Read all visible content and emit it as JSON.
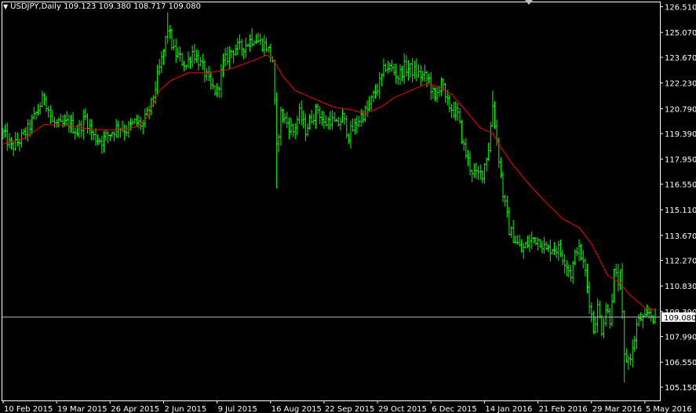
{
  "header": {
    "symbol_timeframe": "USDJPY,Daily",
    "ohlc": "109.123 109.380 108.717 109.080"
  },
  "colors": {
    "background": "#000000",
    "bars": "#00ff00",
    "moving_average": "#ff0000",
    "bid_line": "#c0c0c0",
    "axis": "#ffffff"
  },
  "chart_data": {
    "type": "ohlc",
    "title": "USDJPY,Daily",
    "current_price": 109.08,
    "ylim": [
      104.4,
      126.8
    ],
    "y_ticks": [
      126.51,
      125.07,
      123.67,
      122.23,
      120.79,
      119.39,
      117.95,
      116.55,
      115.11,
      113.67,
      112.27,
      110.83,
      109.39,
      107.99,
      106.55,
      105.15
    ],
    "y_tick_labels": [
      "126.510",
      "125.070",
      "123.670",
      "122.230",
      "120.790",
      "119.390",
      "117.950",
      "116.550",
      "115.110",
      "113.670",
      "112.270",
      "110.830",
      "109.390",
      "107.990",
      "106.550",
      "105.150"
    ],
    "x_ticks": [
      {
        "label": "10 Feb 2015",
        "index": 0
      },
      {
        "label": "19 Mar 2015",
        "index": 26
      },
      {
        "label": "26 Apr 2015",
        "index": 52
      },
      {
        "label": "2 Jun 2015",
        "index": 78
      },
      {
        "label": "9 Jul 2015",
        "index": 104
      },
      {
        "label": "16 Aug 2015",
        "index": 130
      },
      {
        "label": "22 Sep 2015",
        "index": 156
      },
      {
        "label": "29 Oct 2015",
        "index": 182
      },
      {
        "label": "6 Dec 2015",
        "index": 208
      },
      {
        "label": "14 Jan 2016",
        "index": 234
      },
      {
        "label": "21 Feb 2016",
        "index": 260
      },
      {
        "label": "29 Mar 2016",
        "index": 286
      },
      {
        "label": "5 May 2016",
        "index": 312
      }
    ],
    "close_anchors": [
      [
        0,
        119.4
      ],
      [
        4,
        118.6
      ],
      [
        8,
        119.0
      ],
      [
        12,
        119.6
      ],
      [
        16,
        120.5
      ],
      [
        20,
        121.5
      ],
      [
        24,
        120.0
      ],
      [
        28,
        119.8
      ],
      [
        32,
        120.0
      ],
      [
        36,
        119.5
      ],
      [
        40,
        120.3
      ],
      [
        44,
        119.2
      ],
      [
        48,
        119.0
      ],
      [
        52,
        119.4
      ],
      [
        56,
        119.8
      ],
      [
        60,
        119.6
      ],
      [
        64,
        120.0
      ],
      [
        68,
        119.9
      ],
      [
        72,
        121.0
      ],
      [
        75,
        122.5
      ],
      [
        78,
        124.0
      ],
      [
        80,
        125.3
      ],
      [
        83,
        124.0
      ],
      [
        86,
        123.6
      ],
      [
        89,
        123.2
      ],
      [
        92,
        124.0
      ],
      [
        95,
        123.5
      ],
      [
        98,
        122.8
      ],
      [
        101,
        122.0
      ],
      [
        104,
        121.7
      ],
      [
        107,
        123.3
      ],
      [
        110,
        123.9
      ],
      [
        113,
        124.2
      ],
      [
        116,
        124.2
      ],
      [
        119,
        124.5
      ],
      [
        122,
        124.8
      ],
      [
        125,
        124.5
      ],
      [
        128,
        124.3
      ],
      [
        131,
        123.5
      ],
      [
        133,
        118.5
      ],
      [
        135,
        120.5
      ],
      [
        138,
        120.0
      ],
      [
        141,
        119.5
      ],
      [
        144,
        120.5
      ],
      [
        147,
        119.6
      ],
      [
        150,
        120.3
      ],
      [
        153,
        120.8
      ],
      [
        156,
        119.9
      ],
      [
        159,
        120.2
      ],
      [
        162,
        119.8
      ],
      [
        165,
        120.3
      ],
      [
        168,
        119.3
      ],
      [
        171,
        119.8
      ],
      [
        174,
        120.4
      ],
      [
        177,
        120.7
      ],
      [
        180,
        121.5
      ],
      [
        183,
        122.2
      ],
      [
        186,
        123.2
      ],
      [
        189,
        123.0
      ],
      [
        192,
        122.6
      ],
      [
        195,
        123.1
      ],
      [
        198,
        123.0
      ],
      [
        201,
        122.8
      ],
      [
        204,
        122.6
      ],
      [
        207,
        122.4
      ],
      [
        210,
        121.2
      ],
      [
        213,
        122.5
      ],
      [
        215,
        121.2
      ],
      [
        218,
        120.8
      ],
      [
        221,
        120.4
      ],
      [
        224,
        118.6
      ],
      [
        227,
        117.5
      ],
      [
        230,
        117.0
      ],
      [
        233,
        117.2
      ],
      [
        236,
        118.6
      ],
      [
        238,
        121.0
      ],
      [
        240,
        119.0
      ],
      [
        243,
        116.0
      ],
      [
        246,
        114.0
      ],
      [
        249,
        113.4
      ],
      [
        252,
        112.8
      ],
      [
        255,
        113.2
      ],
      [
        258,
        113.5
      ],
      [
        261,
        113.4
      ],
      [
        264,
        112.8
      ],
      [
        267,
        113.0
      ],
      [
        270,
        112.9
      ],
      [
        273,
        112.3
      ],
      [
        276,
        111.5
      ],
      [
        279,
        113.0
      ],
      [
        281,
        112.5
      ],
      [
        283,
        111.6
      ],
      [
        285,
        110.0
      ],
      [
        287,
        108.4
      ],
      [
        289,
        109.6
      ],
      [
        291,
        108.4
      ],
      [
        293,
        109.6
      ],
      [
        295,
        109.0
      ],
      [
        297,
        111.5
      ],
      [
        299,
        111.1
      ],
      [
        300,
        111.4
      ],
      [
        302,
        106.8
      ],
      [
        304,
        106.7
      ],
      [
        306,
        107.2
      ],
      [
        308,
        108.6
      ],
      [
        310,
        109.0
      ],
      [
        312,
        108.9
      ],
      [
        314,
        109.3
      ],
      [
        316,
        109.1
      ]
    ],
    "ma_anchors": [
      [
        0,
        118.8
      ],
      [
        10,
        119.1
      ],
      [
        20,
        119.9
      ],
      [
        34,
        119.8
      ],
      [
        44,
        119.6
      ],
      [
        58,
        119.6
      ],
      [
        66,
        119.8
      ],
      [
        70,
        120.3
      ],
      [
        76,
        121.8
      ],
      [
        82,
        122.4
      ],
      [
        90,
        122.8
      ],
      [
        100,
        122.8
      ],
      [
        110,
        123.0
      ],
      [
        122,
        123.5
      ],
      [
        128,
        123.8
      ],
      [
        131,
        123.6
      ],
      [
        136,
        122.6
      ],
      [
        142,
        121.8
      ],
      [
        150,
        121.4
      ],
      [
        160,
        120.9
      ],
      [
        170,
        120.7
      ],
      [
        176,
        120.5
      ],
      [
        184,
        120.9
      ],
      [
        190,
        121.4
      ],
      [
        198,
        121.8
      ],
      [
        206,
        122.2
      ],
      [
        212,
        122.0
      ],
      [
        218,
        121.6
      ],
      [
        224,
        120.8
      ],
      [
        232,
        119.7
      ],
      [
        238,
        119.4
      ],
      [
        242,
        118.6
      ],
      [
        248,
        117.6
      ],
      [
        256,
        116.5
      ],
      [
        264,
        115.5
      ],
      [
        272,
        114.6
      ],
      [
        280,
        114.1
      ],
      [
        286,
        113.2
      ],
      [
        290,
        112.3
      ],
      [
        294,
        111.4
      ],
      [
        300,
        111.0
      ],
      [
        304,
        110.4
      ],
      [
        308,
        110.0
      ],
      [
        312,
        109.6
      ],
      [
        316,
        109.5
      ]
    ],
    "notable_bars": [
      {
        "index": 80,
        "high": 126.2
      },
      {
        "index": 121,
        "high": 125.3
      },
      {
        "index": 133,
        "low": 116.3
      },
      {
        "index": 238,
        "high": 121.8
      },
      {
        "index": 302,
        "low": 105.4
      },
      {
        "index": 300,
        "high": 111.7
      }
    ]
  }
}
